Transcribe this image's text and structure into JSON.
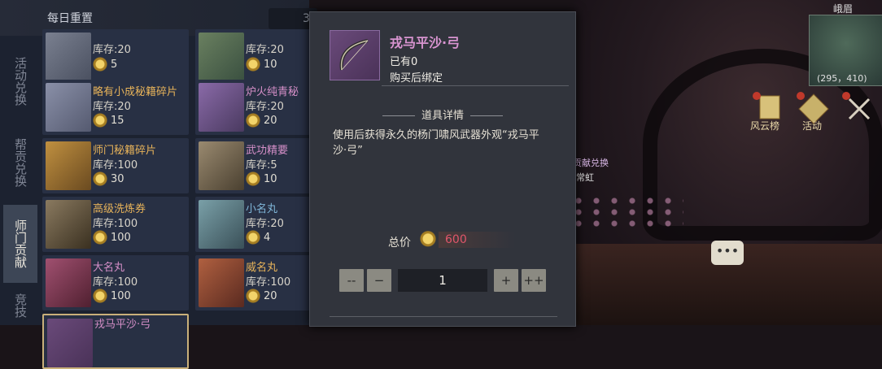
{
  "shop": {
    "header_title": "每日重置",
    "timer_digit": "3",
    "tabs": [
      {
        "label": "活动兑换",
        "active": false
      },
      {
        "label": "帮贡兑换",
        "active": false
      },
      {
        "label": "师门贡献",
        "active": true
      },
      {
        "label": "竞技",
        "active": false
      }
    ],
    "items": [
      {
        "name": "",
        "stock": "库存:20",
        "price": "5"
      },
      {
        "name": "",
        "stock": "库存:20",
        "price": "10"
      },
      {
        "name": "略有小成秘籍碎片",
        "stock": "库存:20",
        "price": "15"
      },
      {
        "name": "炉火纯青秘",
        "stock": "库存:20",
        "price": "20"
      },
      {
        "name": "师门秘籍碎片",
        "stock": "库存:100",
        "price": "30"
      },
      {
        "name": "武功精要",
        "stock": "库存:5",
        "price": "10"
      },
      {
        "name": "高级洗炼券",
        "stock": "库存:100",
        "price": "100"
      },
      {
        "name": "小名丸",
        "stock": "库存:20",
        "price": "4"
      },
      {
        "name": "大名丸",
        "stock": "库存:100",
        "price": "100"
      },
      {
        "name": "威名丸",
        "stock": "库存:100",
        "price": "20"
      },
      {
        "name": "戎马平沙·弓",
        "stock": "",
        "price": ""
      }
    ]
  },
  "dialog": {
    "item_name": "戎马平沙·弓",
    "owned": "已有0",
    "bind": "购买后绑定",
    "detail_title": "道具详情",
    "description": "使用后获得永久的杨门啸风武器外观“戎马平沙·弓”",
    "total_label": "总价",
    "total_value": "600",
    "quantity": "1",
    "btn_min": "--",
    "btn_dec": "−",
    "btn_inc": "+",
    "btn_max": "++"
  },
  "hud": {
    "map_label": "峨眉",
    "coords": "(295，410)",
    "feng_yun": "风云榜",
    "huo_dong": "活动",
    "scene_text1": "贡献兑换",
    "scene_text2": "常虹",
    "chat_icon": "chat-bubble-icon"
  },
  "colors": {
    "item_name_gold": "#e7b35a",
    "item_name_pink": "#d58fc8",
    "price_red": "#e0566a"
  }
}
